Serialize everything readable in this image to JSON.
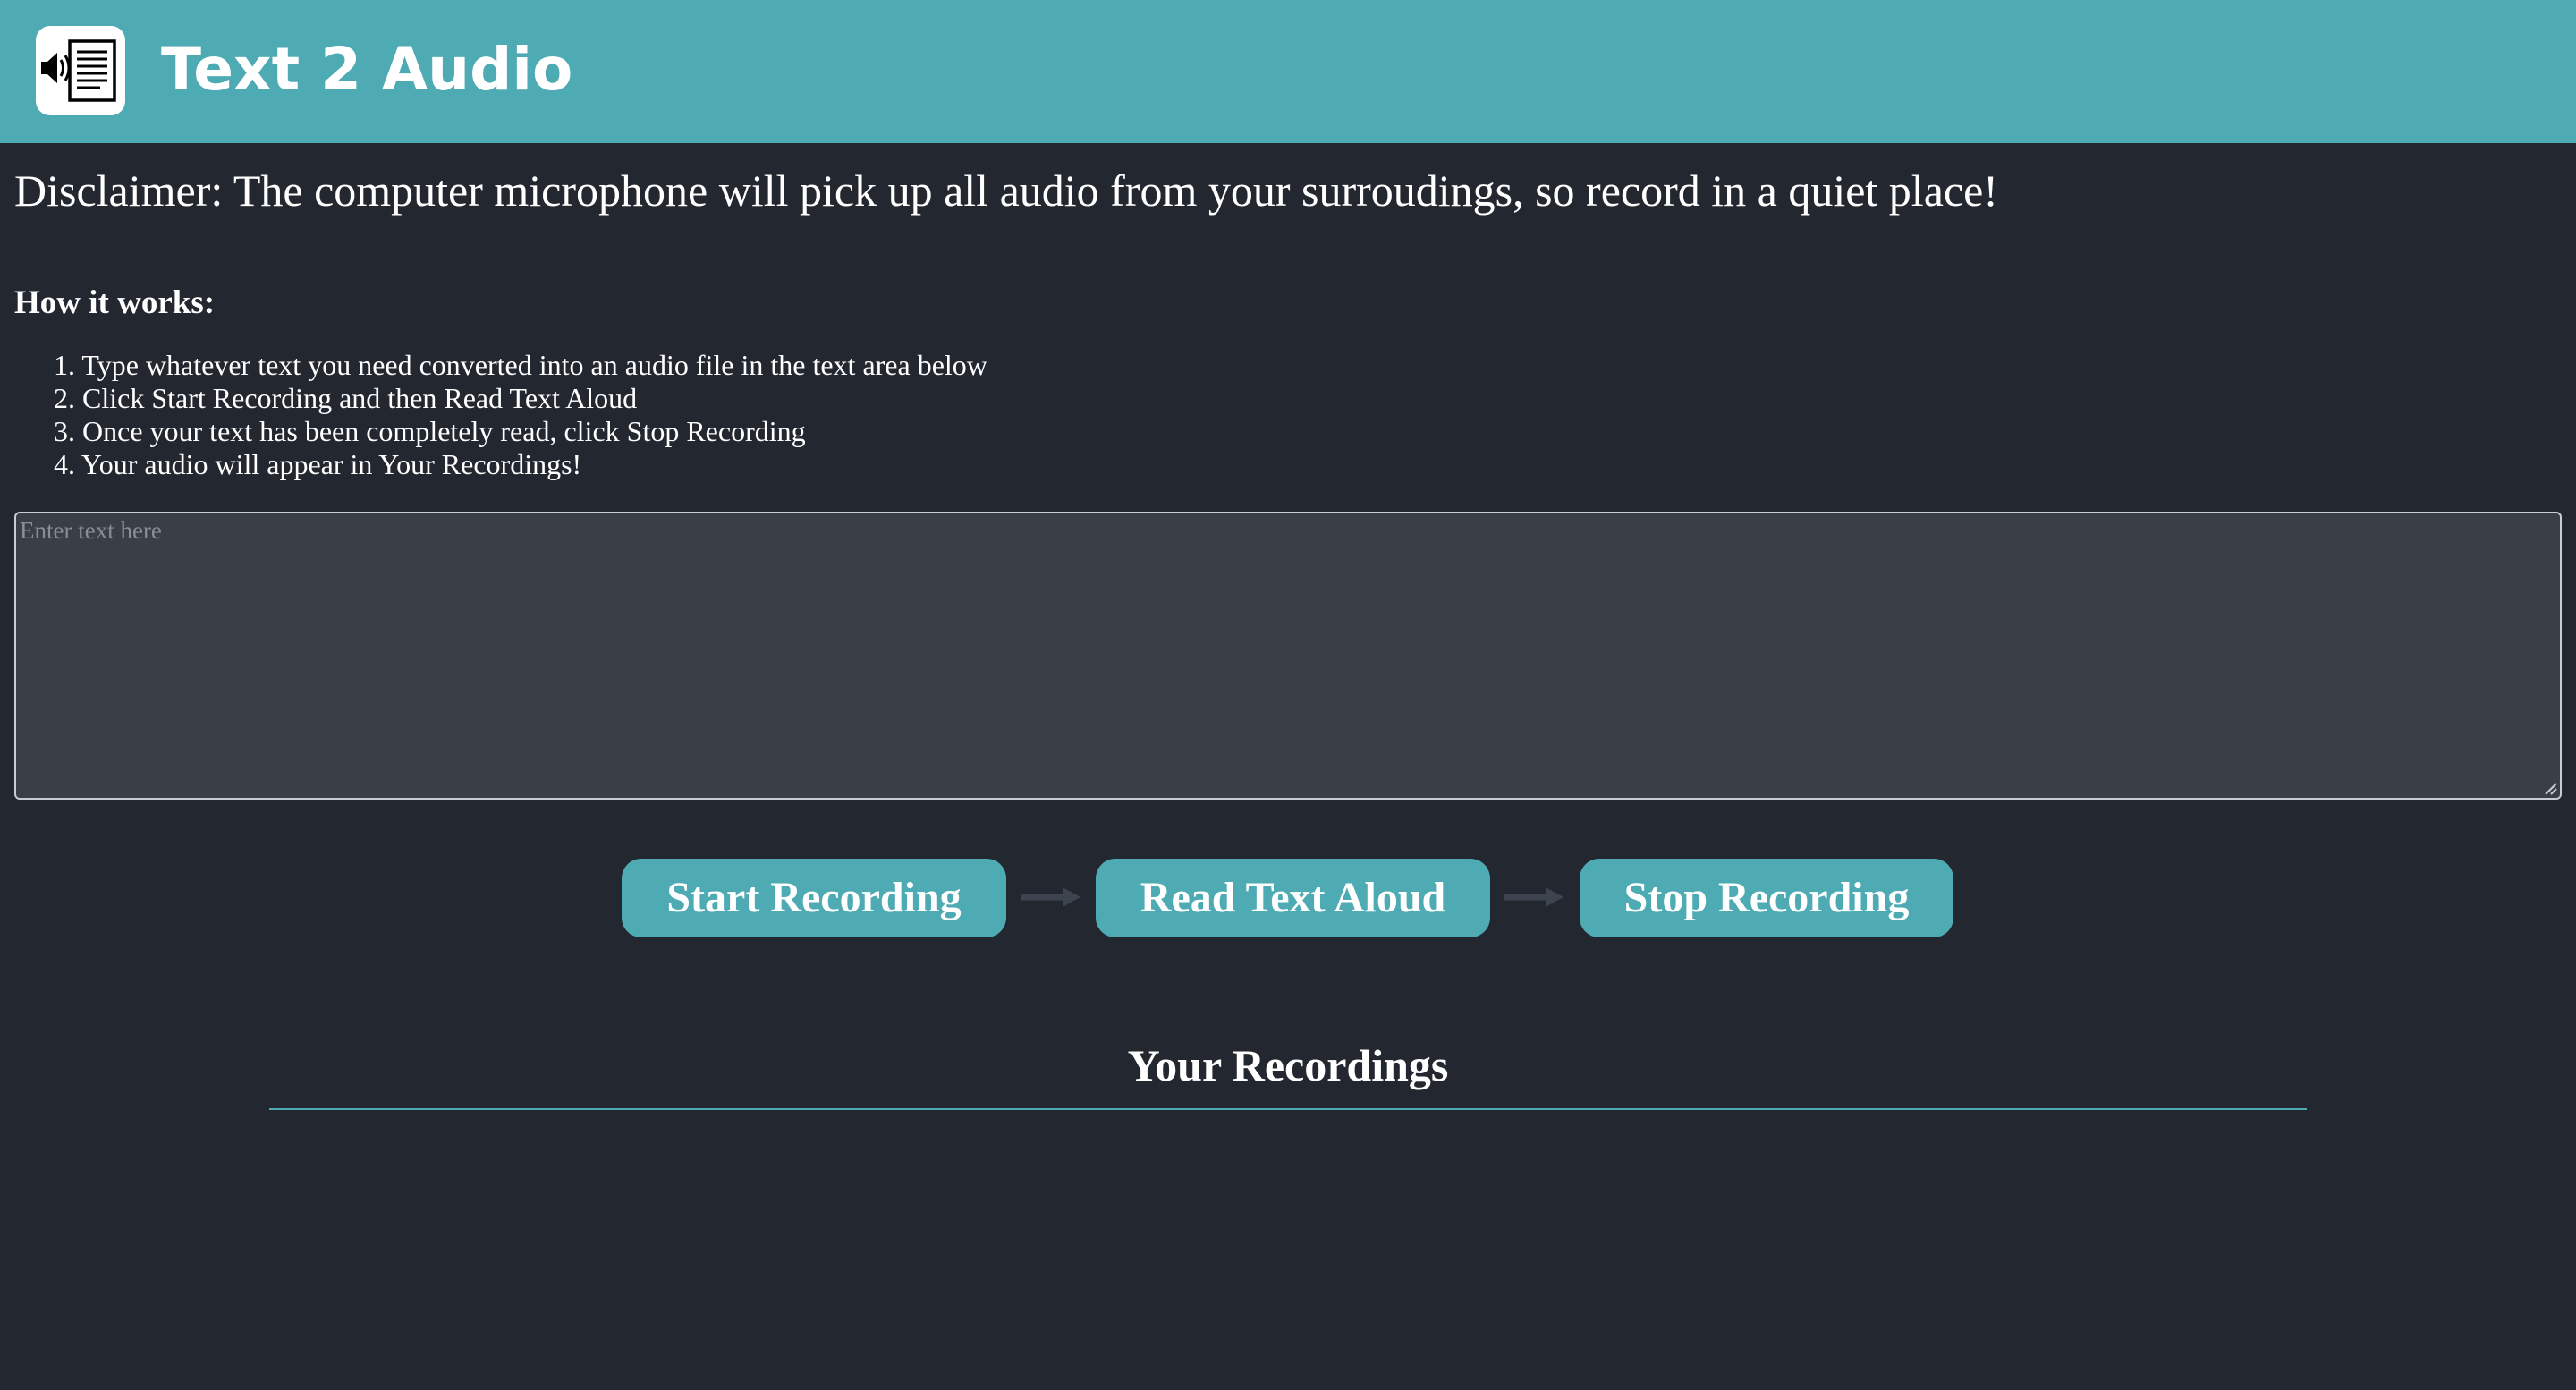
{
  "header": {
    "logo_icon": "speaker-document-icon",
    "title": "Text 2 Audio",
    "color": "#4eabb4"
  },
  "disclaimer": "Disclaimer: The computer microphone will pick up all audio from your surroudings, so record in a quiet place!",
  "how_it_works": {
    "title": "How it works:",
    "steps": [
      "1. Type whatever text you need converted into an audio file in the text area below",
      "2. Click Start Recording and then Read Text Aloud",
      "3. Once your text has been completely read, click Stop Recording",
      "4. Your audio will appear in Your Recordings!"
    ]
  },
  "text_input": {
    "value": "",
    "placeholder": "Enter text here"
  },
  "controls": {
    "start_label": "Start Recording",
    "read_label": "Read Text Aloud",
    "stop_label": "Stop Recording",
    "arrow_icon": "right-arrow-icon"
  },
  "recordings": {
    "title": "Your Recordings",
    "items": []
  },
  "colors": {
    "background": "#23272f",
    "accent": "#4eabb4",
    "textarea_bg": "#3a3e47"
  }
}
